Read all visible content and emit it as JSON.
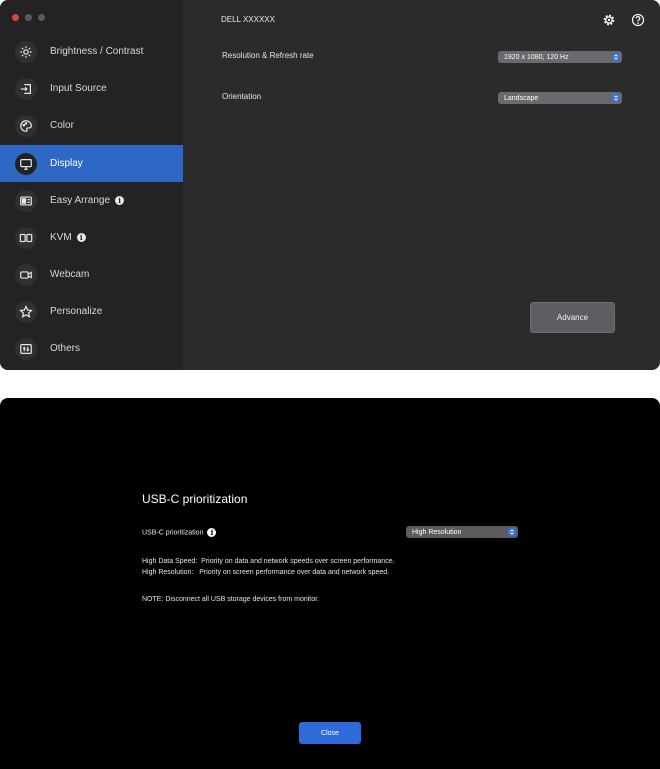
{
  "window": {
    "title": "DELL XXXXXX",
    "sidebar": {
      "items": [
        {
          "label": "Brightness / Contrast",
          "icon": "brightness-icon",
          "active": false,
          "info": false
        },
        {
          "label": "Input Source",
          "icon": "input-source-icon",
          "active": false,
          "info": false
        },
        {
          "label": "Color",
          "icon": "color-icon",
          "active": false,
          "info": false
        },
        {
          "label": "Display",
          "icon": "display-icon",
          "active": true,
          "info": false
        },
        {
          "label": "Easy Arrange",
          "icon": "easy-arrange-icon",
          "active": false,
          "info": true
        },
        {
          "label": "KVM",
          "icon": "kvm-icon",
          "active": false,
          "info": true
        },
        {
          "label": "Webcam",
          "icon": "webcam-icon",
          "active": false,
          "info": false
        },
        {
          "label": "Personalize",
          "icon": "star-icon",
          "active": false,
          "info": false
        },
        {
          "label": "Others",
          "icon": "others-icon",
          "active": false,
          "info": false
        }
      ]
    },
    "settings": {
      "resolution_label": "Resolution & Refresh rate",
      "resolution_value": "1920 x 1080, 120 Hz",
      "orientation_label": "Orientation",
      "orientation_value": "Landscape"
    },
    "advance_label": "Advance",
    "info_glyph": "i"
  },
  "dialog": {
    "title": "USB-C prioritization",
    "setting_label": "USB-C prioritization",
    "setting_value": "High Resolution",
    "line1": "High Data Speed:  Priority on data and network speeds over screen performance.",
    "line2": "High Resolution:   Priority on screen performance over data and network speed.",
    "note": "NOTE: Disconnect all USB storage devices from monitor.",
    "close_label": "Close"
  },
  "colors": {
    "accent": "#2e67c4",
    "button_blue": "#2f6bd8"
  }
}
